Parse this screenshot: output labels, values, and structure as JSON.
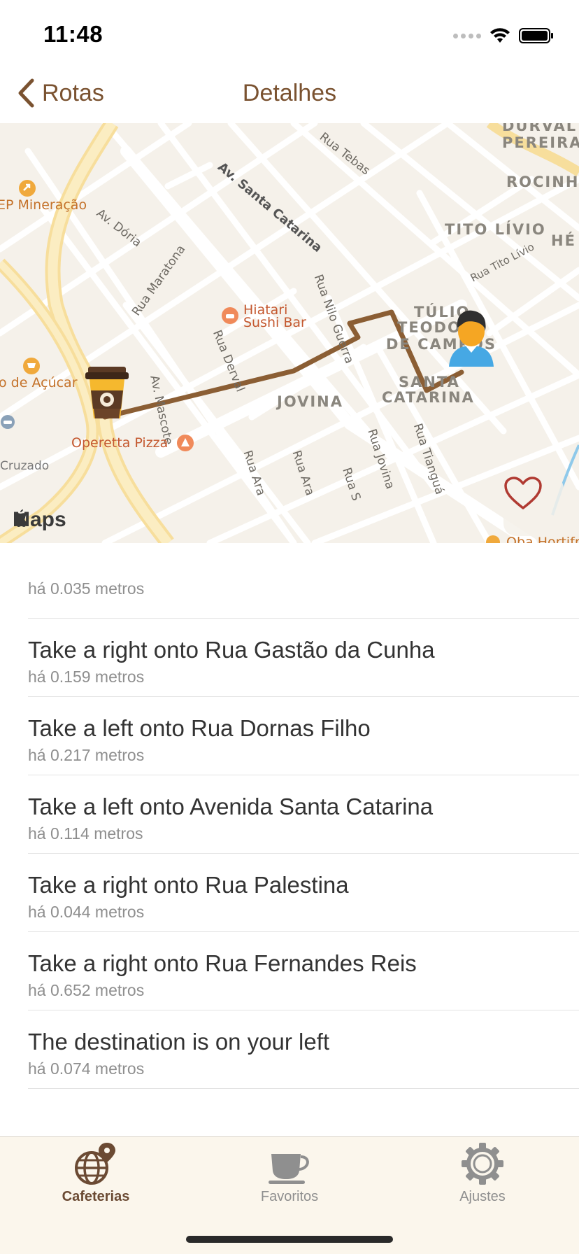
{
  "status_bar": {
    "time": "11:48"
  },
  "nav": {
    "back_label": "Rotas",
    "title": "Detalhes"
  },
  "map": {
    "streets": [
      "Rua Tebas",
      "Av. Santa Catarina",
      "Av. Dória",
      "Rua Maratona",
      "Rua Nilo Guerra",
      "Rua Derval",
      "Av. Mascote",
      "Rua Tito Lívio",
      "Rua Jovina",
      "Rua Tianguá",
      "Rua Ara",
      "Rua Ara",
      "Rua S"
    ],
    "districts": [
      "DURVAL",
      "PEREIRA",
      "ROCINH",
      "TITO LÍVIO",
      "HÉ",
      "TÚLIO",
      "TEODORO",
      "DE CAMPOS",
      "SANTA",
      "CATARINA",
      "JOVINA"
    ],
    "pois": [
      "EP Mineração",
      "Hiatari",
      "Sushi Bar",
      "o de Açúcar",
      "Operetta Pizza",
      "Cruzado",
      "Oba Hortifr"
    ],
    "logo": "Maps",
    "route_color": "#8b5e34"
  },
  "directions": [
    {
      "instruction": "",
      "distance": "há 0.035 metros"
    },
    {
      "instruction": "Take a right onto Rua Gastão da Cunha",
      "distance": "há 0.159 metros"
    },
    {
      "instruction": "Take a left onto Rua Dornas Filho",
      "distance": "há 0.217 metros"
    },
    {
      "instruction": "Take a left onto Avenida Santa Catarina",
      "distance": "há 0.114 metros"
    },
    {
      "instruction": "Take a right onto Rua Palestina",
      "distance": "há 0.044 metros"
    },
    {
      "instruction": "Take a right onto Rua Fernandes Reis",
      "distance": "há 0.652 metros"
    },
    {
      "instruction": "The destination is on your left",
      "distance": "há 0.074 metros"
    }
  ],
  "tabs": [
    {
      "label": "Cafeterias",
      "icon": "globe-pin-icon",
      "active": true
    },
    {
      "label": "Favoritos",
      "icon": "coffee-cup-icon",
      "active": false
    },
    {
      "label": "Ajustes",
      "icon": "gear-icon",
      "active": false
    }
  ],
  "colors": {
    "accent": "#7a5230",
    "tab_active": "#6b4a33",
    "favorite": "#b03a32"
  }
}
